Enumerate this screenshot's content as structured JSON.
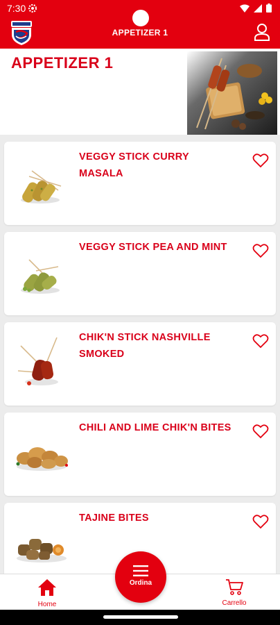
{
  "status_bar": {
    "time": "7:30"
  },
  "app_bar": {
    "title": "APPETIZER 1"
  },
  "category": {
    "title": "APPETIZER 1"
  },
  "products": [
    {
      "name": "VEGGY STICK CURRY MASALA"
    },
    {
      "name": "VEGGY STICK PEA AND MINT"
    },
    {
      "name": "CHIK'N STICK NASHVILLE SMOKED"
    },
    {
      "name": "CHILI AND LIME CHIK'N BITES"
    },
    {
      "name": "TAJINE BITES"
    }
  ],
  "bottom_nav": {
    "home_label": "Home",
    "order_label": "Ordina",
    "cart_label": "Carrello"
  },
  "colors": {
    "brand_red": "#e3000f",
    "title_red": "#d9001a",
    "background": "#ececec"
  }
}
